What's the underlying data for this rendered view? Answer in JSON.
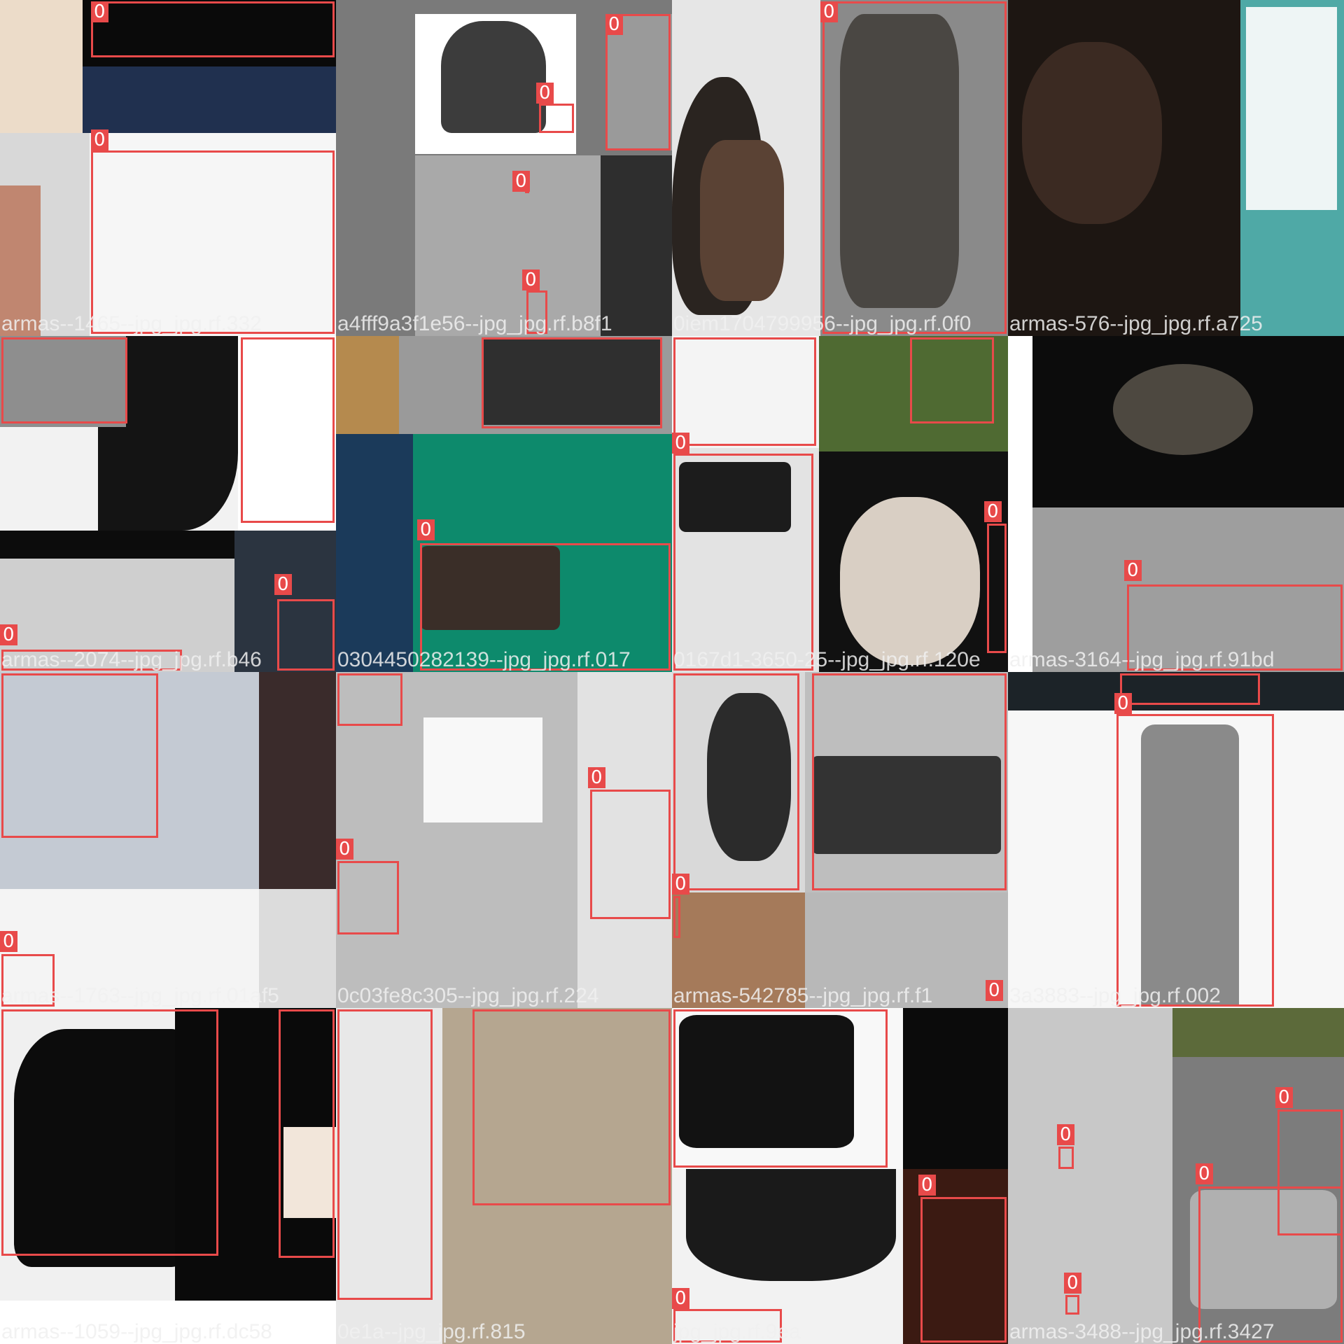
{
  "box_color": "#e84a4a",
  "box_label": "0",
  "tiles": [
    {
      "caption": "armas--1465--jpg_jpg.rf.332"
    },
    {
      "caption": "a4fff9a3f1e56--jpg_jpg.rf.b8f1"
    },
    {
      "caption": "0iem1704799956--jpg_jpg.rf.0f0"
    },
    {
      "caption": "armas-576--jpg_jpg.rf.a725"
    },
    {
      "caption": "armas--2074--jpg_jpg.rf.b46"
    },
    {
      "caption": "0304450282139--jpg_jpg.rf.017"
    },
    {
      "caption": "0167d1-3650-25--jpg_jpg.rf.120e"
    },
    {
      "caption": "armas-3164--jpg_jpg.rf.91bd"
    },
    {
      "caption": "armas--1763--jpg_jpg.rf.01af5"
    },
    {
      "caption": "0c03fe8c305--jpg_jpg.rf.224"
    },
    {
      "caption": "armas-542785--jpg_jpg.rf.f1"
    },
    {
      "caption": "3a3883--jpg_jpg.rf.002"
    },
    {
      "caption": "armas--1059--jpg_jpg.rf.dc58"
    },
    {
      "caption": "0e1a--jpg_jpg.rf.815"
    },
    {
      "caption": "jpg_jpg.rf.9ea"
    },
    {
      "caption": "armas-3488--jpg_jpg.rf.3427"
    }
  ]
}
